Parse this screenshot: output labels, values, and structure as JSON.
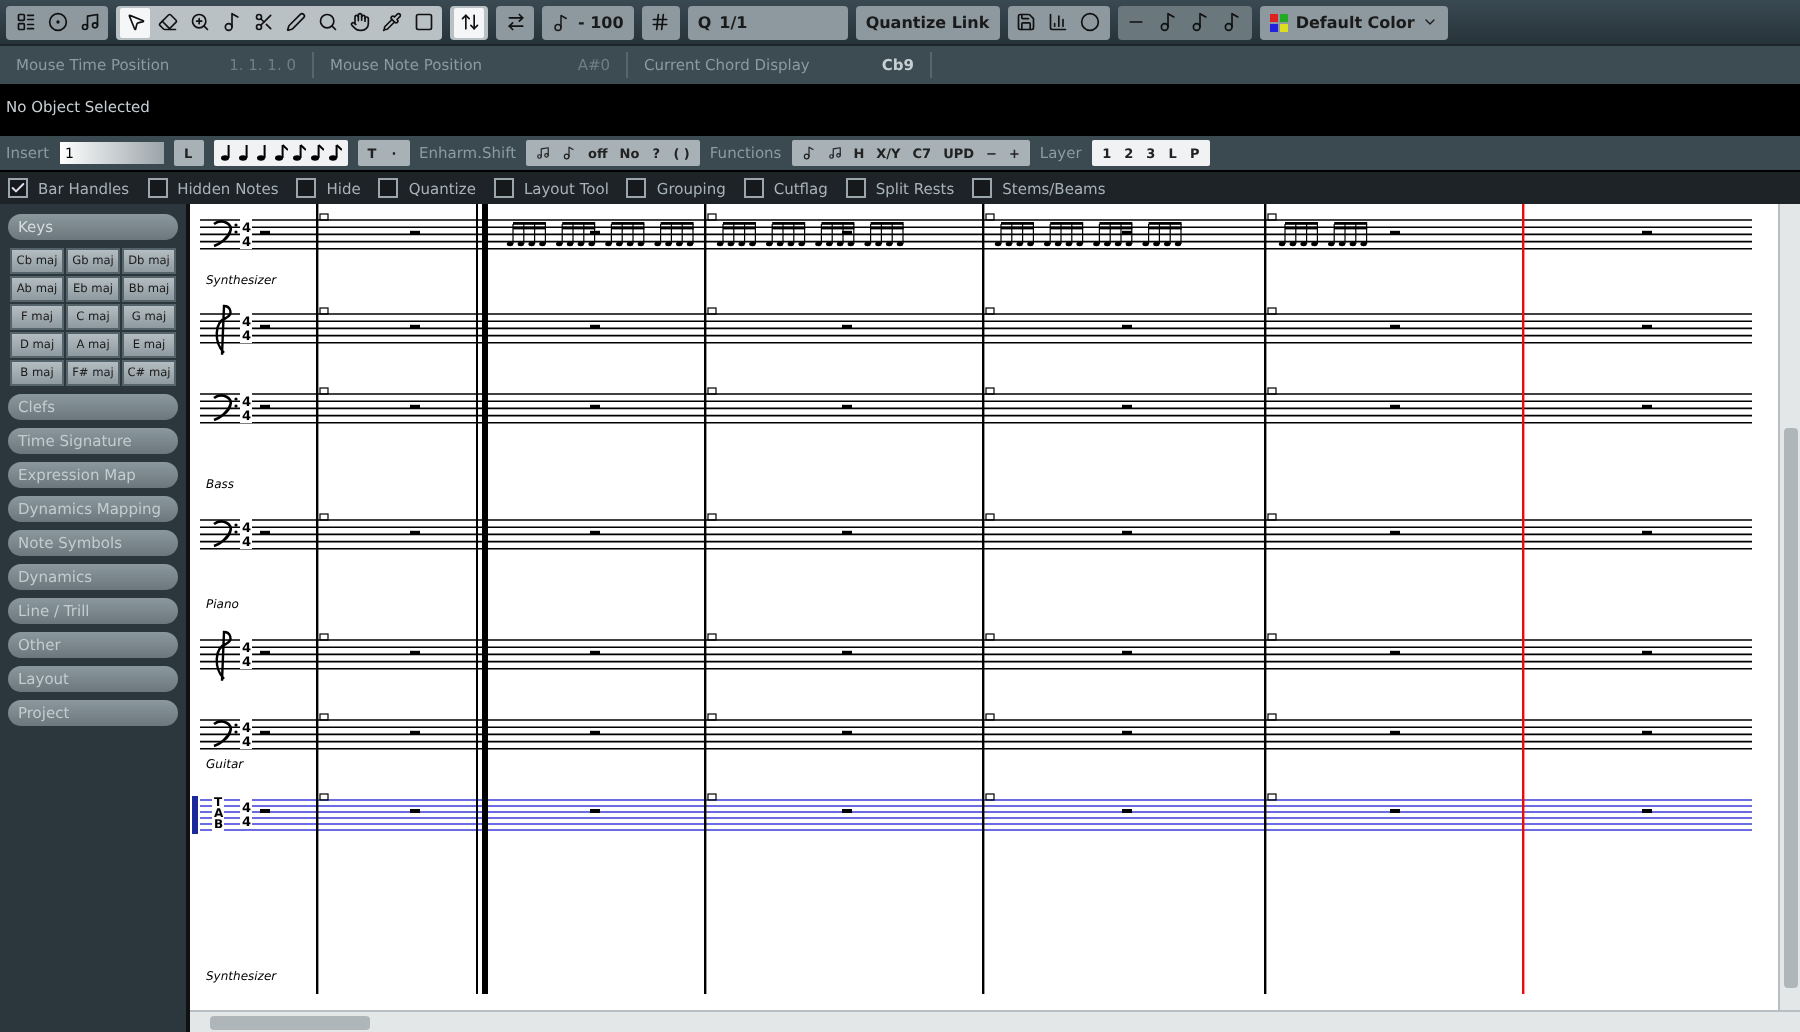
{
  "toolbar": {
    "tempo": "- 100",
    "quantize": {
      "prefix": "Q",
      "value": "1/1"
    },
    "quantize_link": "Quantize Link",
    "color_menu": "Default Color"
  },
  "info_bar": [
    {
      "label": "Mouse Time Position",
      "value": "1.  1.  1.    0"
    },
    {
      "label": "Mouse Note Position",
      "value": "A#0"
    },
    {
      "label": "Current Chord Display",
      "value": "Cb9"
    }
  ],
  "status": "No Object Selected",
  "edit_bar": {
    "insert_label": "Insert",
    "insert_value": "1",
    "insert_button": "L",
    "tuplet_buttons": [
      "T",
      "·"
    ],
    "enharm_label": "Enharm.Shift",
    "enharm_buttons": [
      "off",
      "No",
      "?",
      "( )"
    ],
    "functions_label": "Functions",
    "function_buttons": [
      "H",
      "X/Y",
      "C7",
      "UPD",
      "−",
      "+"
    ],
    "layer_label": "Layer",
    "layers": [
      "1",
      "2",
      "3",
      "L",
      "P"
    ]
  },
  "filters": [
    {
      "label": "Bar Handles",
      "checked": true
    },
    {
      "label": "Hidden Notes",
      "checked": false
    },
    {
      "label": "Hide",
      "checked": false
    },
    {
      "label": "Quantize",
      "checked": false
    },
    {
      "label": "Layout Tool",
      "checked": false
    },
    {
      "label": "Grouping",
      "checked": false
    },
    {
      "label": "Cutflag",
      "checked": false
    },
    {
      "label": "Split Rests",
      "checked": false
    },
    {
      "label": "Stems/Beams",
      "checked": false
    }
  ],
  "symbols": [
    {
      "label": "Keys",
      "expanded": true,
      "keys": [
        "Cb maj",
        "Gb maj",
        "Db maj",
        "Ab maj",
        "Eb maj",
        "Bb maj",
        "F maj",
        "C maj",
        "G maj",
        "D maj",
        "A maj",
        "E maj",
        "B maj",
        "F# maj",
        "C# maj"
      ]
    },
    {
      "label": "Clefs",
      "expanded": false
    },
    {
      "label": "Time Signature",
      "expanded": false
    },
    {
      "label": "Expression Map",
      "expanded": false
    },
    {
      "label": "Dynamics Mapping",
      "expanded": false
    },
    {
      "label": "Note Symbols",
      "expanded": false
    },
    {
      "label": "Dynamics",
      "expanded": false
    },
    {
      "label": "Line / Trill",
      "expanded": false
    },
    {
      "label": "Other",
      "expanded": false
    },
    {
      "label": "Layout",
      "expanded": false
    },
    {
      "label": "Project",
      "expanded": false
    }
  ],
  "score": {
    "items": [
      {
        "kind": "bass_staff",
        "meter": [
          "4",
          "4"
        ],
        "selected": false
      },
      {
        "kind": "label",
        "text": "Synthesizer"
      },
      {
        "kind": "treble_staff",
        "meter": [
          "4",
          "4"
        ],
        "selected": false
      },
      {
        "kind": "bass_staff",
        "meter": [
          "4",
          "4"
        ],
        "selected": false
      },
      {
        "kind": "label",
        "text": "Bass"
      },
      {
        "kind": "bass_staff",
        "meter": [
          "4",
          "4"
        ],
        "selected": false
      },
      {
        "kind": "label",
        "text": "Piano"
      },
      {
        "kind": "treble_staff",
        "meter": [
          "4",
          "4"
        ],
        "selected": false
      },
      {
        "kind": "bass_staff",
        "meter": [
          "4",
          "4"
        ],
        "selected": false
      },
      {
        "kind": "label",
        "text": "Guitar"
      },
      {
        "kind": "tab_staff",
        "clef_text": "TAB",
        "meter": [
          "4",
          "4"
        ],
        "selected": true
      },
      {
        "kind": "label",
        "text": "Synthesizer"
      }
    ]
  }
}
